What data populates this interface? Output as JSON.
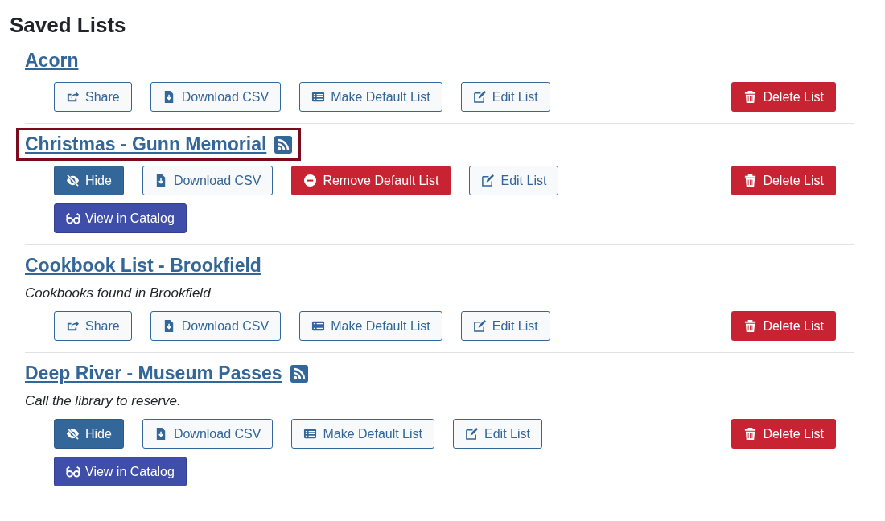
{
  "heading": "Saved Lists",
  "lists": [
    {
      "title": "Acorn",
      "rss": false,
      "highlighted": false,
      "buttons": [
        {
          "label": "Share",
          "kind": "share"
        },
        {
          "label": "Download CSV",
          "kind": "download"
        },
        {
          "label": "Make Default List",
          "kind": "make-default"
        },
        {
          "label": "Edit List",
          "kind": "edit"
        }
      ],
      "delete_label": "Delete List"
    },
    {
      "title": "Christmas - Gunn Memorial",
      "rss": true,
      "highlighted": true,
      "buttons": [
        {
          "label": "Hide",
          "kind": "hide"
        },
        {
          "label": "Download CSV",
          "kind": "download"
        },
        {
          "label": "Remove Default List",
          "kind": "remove-default"
        },
        {
          "label": "Edit List",
          "kind": "edit"
        },
        {
          "label": "View in Catalog",
          "kind": "view"
        }
      ],
      "delete_label": "Delete List"
    },
    {
      "title": "Cookbook List - Brookfield",
      "rss": false,
      "highlighted": false,
      "description": "Cookbooks found in Brookfield",
      "buttons": [
        {
          "label": "Share",
          "kind": "share"
        },
        {
          "label": "Download CSV",
          "kind": "download"
        },
        {
          "label": "Make Default List",
          "kind": "make-default"
        },
        {
          "label": "Edit List",
          "kind": "edit"
        }
      ],
      "delete_label": "Delete List"
    },
    {
      "title": "Deep River - Museum Passes",
      "rss": true,
      "highlighted": false,
      "description": "Call the library to reserve.",
      "buttons": [
        {
          "label": "Hide",
          "kind": "hide"
        },
        {
          "label": "Download CSV",
          "kind": "download"
        },
        {
          "label": "Make Default List",
          "kind": "make-default"
        },
        {
          "label": "Edit List",
          "kind": "edit"
        },
        {
          "label": "View in Catalog",
          "kind": "view"
        }
      ],
      "delete_label": "Delete List"
    }
  ]
}
